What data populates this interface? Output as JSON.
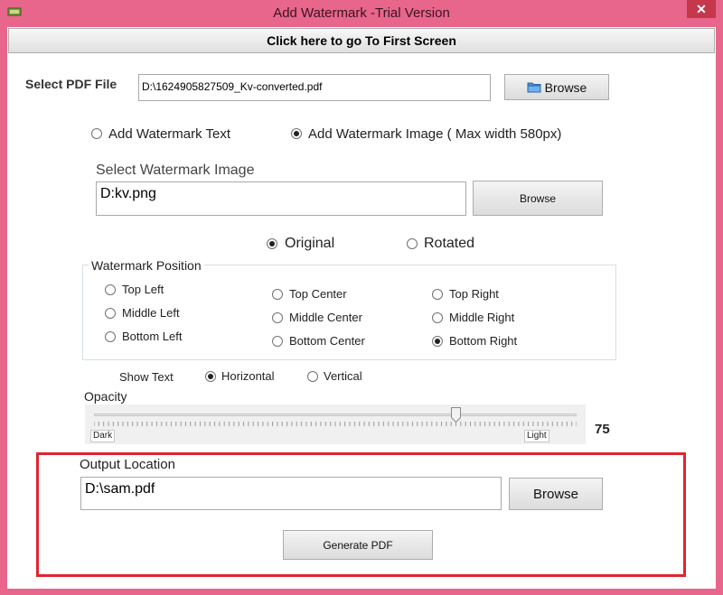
{
  "window": {
    "title": "Add Watermark  -Trial Version",
    "close_glyph": "✕"
  },
  "first_screen_button": "Click here to go To First Screen",
  "pdf": {
    "label": "Select PDF File",
    "path": "D:\\1624905827509_Kv-converted.pdf",
    "browse": "Browse",
    "browse_icon": "folder-icon"
  },
  "mode": {
    "text_option": "Add Watermark Text",
    "image_option": "Add Watermark Image ( Max width 580px)",
    "selected": "image"
  },
  "image": {
    "label": "Select Watermark Image",
    "path": "D:kv.png",
    "browse": "Browse"
  },
  "orientation": {
    "original": "Original",
    "rotated": "Rotated",
    "selected": "original"
  },
  "position": {
    "title": "Watermark Position",
    "options": [
      "Top Left",
      "Middle Left",
      "Bottom Left",
      "Top Center",
      "Middle Center",
      "Bottom Center",
      "Top Right",
      "Middle Right",
      "Bottom Right"
    ],
    "selected": "Bottom Right"
  },
  "show_text": {
    "label": "Show Text",
    "horizontal": "Horizontal",
    "vertical": "Vertical",
    "selected": "horizontal"
  },
  "opacity": {
    "label": "Opacity",
    "value": "75",
    "min_label": "Dark",
    "max_label": "Light",
    "fraction": 0.75
  },
  "output": {
    "label": "Output Location",
    "path": "D:\\sam.pdf",
    "browse": "Browse",
    "generate": "Generate PDF"
  },
  "colors": {
    "frame": "#e8658c",
    "close": "#c5384c",
    "highlight": "#e0252f"
  }
}
